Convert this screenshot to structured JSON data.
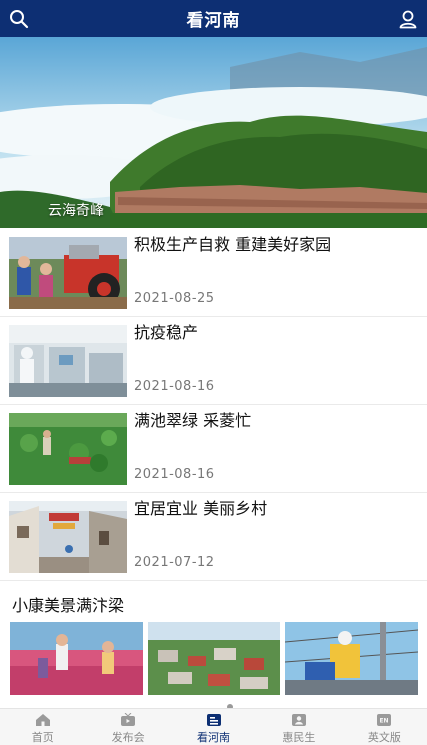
{
  "header": {
    "title": "看河南",
    "search_icon": "search-icon",
    "profile_icon": "user-icon"
  },
  "hero": {
    "caption": "云海奇峰"
  },
  "news": [
    {
      "headline": "积极生产自救 重建美好家园",
      "date": "2021-08-25"
    },
    {
      "headline": "抗疫稳产",
      "date": "2021-08-16"
    },
    {
      "headline": "满池翠绿 采菱忙",
      "date": "2021-08-16"
    },
    {
      "headline": "宜居宜业 美丽乡村",
      "date": "2021-07-12"
    }
  ],
  "section": {
    "title": "小康美景满汴梁"
  },
  "tabs": [
    {
      "label": "首页",
      "icon": "home-icon"
    },
    {
      "label": "发布会",
      "icon": "tv-icon"
    },
    {
      "label": "看河南",
      "icon": "news-icon",
      "active": true
    },
    {
      "label": "惠民生",
      "icon": "people-icon"
    },
    {
      "label": "英文版",
      "icon": "en-icon"
    }
  ],
  "colors": {
    "header_bg": "#0d2f73",
    "active_tab": "#0d2f73"
  }
}
